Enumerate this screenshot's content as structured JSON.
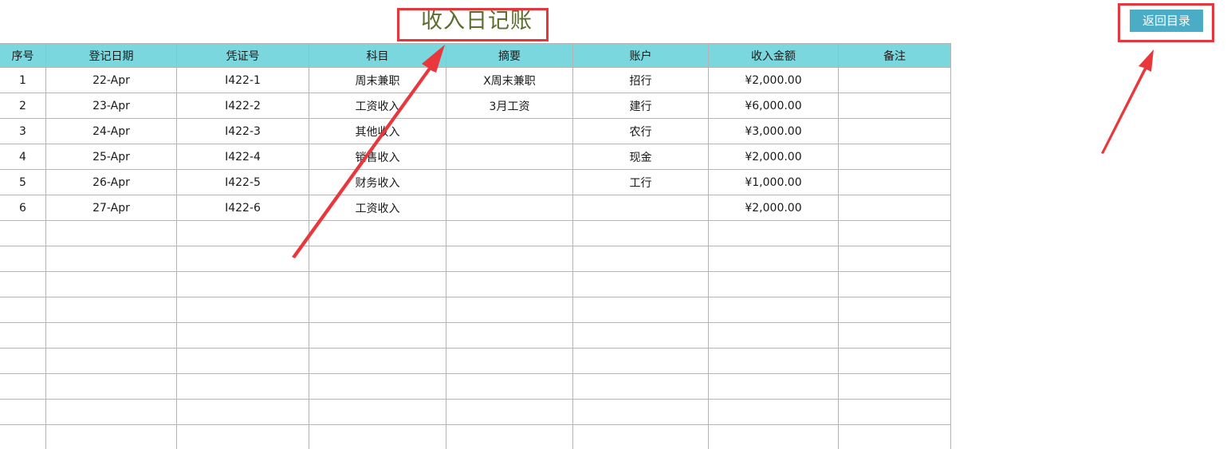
{
  "sheet": {
    "title": "收入日记账",
    "back_button_label": "返回目录",
    "columns": [
      "序号",
      "登记日期",
      "凭证号",
      "科目",
      "摘要",
      "账户",
      "收入金额",
      "备注"
    ],
    "rows": [
      {
        "no": "1",
        "date": "22-Apr",
        "voucher": "I422-1",
        "subject": "周末兼职",
        "summary": "X周末兼职",
        "account": "招行",
        "amount": "¥2,000.00",
        "note": ""
      },
      {
        "no": "2",
        "date": "23-Apr",
        "voucher": "I422-2",
        "subject": "工资收入",
        "summary": "3月工资",
        "account": "建行",
        "amount": "¥6,000.00",
        "note": ""
      },
      {
        "no": "3",
        "date": "24-Apr",
        "voucher": "I422-3",
        "subject": "其他收入",
        "summary": "",
        "account": "农行",
        "amount": "¥3,000.00",
        "note": ""
      },
      {
        "no": "4",
        "date": "25-Apr",
        "voucher": "I422-4",
        "subject": "销售收入",
        "summary": "",
        "account": "现金",
        "amount": "¥2,000.00",
        "note": ""
      },
      {
        "no": "5",
        "date": "26-Apr",
        "voucher": "I422-5",
        "subject": "财务收入",
        "summary": "",
        "account": "工行",
        "amount": "¥1,000.00",
        "note": ""
      },
      {
        "no": "6",
        "date": "27-Apr",
        "voucher": "I422-6",
        "subject": "工资收入",
        "summary": "",
        "account": "",
        "amount": "¥2,000.00",
        "note": ""
      }
    ],
    "empty_row_count": 9
  },
  "colors": {
    "header_bg": "#79d7dd",
    "title_color": "#5a6e2e",
    "button_bg": "#4bacc6",
    "highlight": "#e8353b"
  }
}
